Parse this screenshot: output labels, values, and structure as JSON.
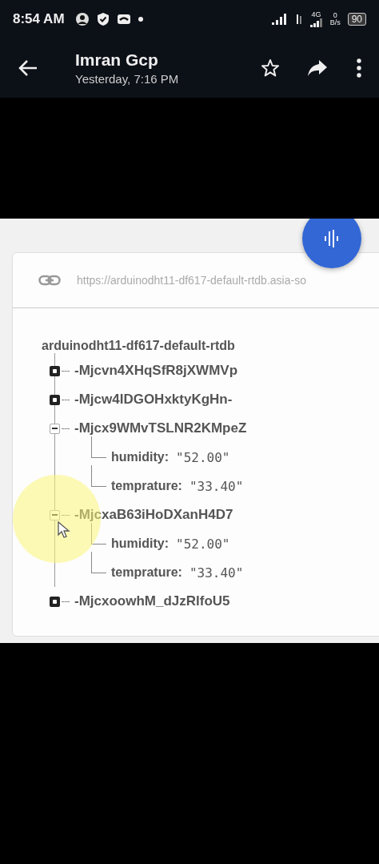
{
  "status_bar": {
    "time": "8:54 AM",
    "network": "4G",
    "speed_value": "0",
    "speed_unit": "B/s",
    "battery": "90"
  },
  "app_bar": {
    "title": "Imran Gcp",
    "subtitle": "Yesterday, 7:16 PM"
  },
  "image": {
    "url": "https://arduinodht11-df617-default-rtdb.asia-so",
    "tree": {
      "root": "arduinodht11-df617-default-rtdb",
      "children": [
        {
          "key": "-Mjcvn4XHqSfR8jXWMVp",
          "expanded": false
        },
        {
          "key": "-Mjcw4IDGOHxktyKgHn-",
          "expanded": false
        },
        {
          "key": "-Mjcx9WMvTSLNR2KMpeZ",
          "expanded": true,
          "children": [
            {
              "key": "humidity:",
              "value": "\"52.00\""
            },
            {
              "key": "temprature:",
              "value": "\"33.40\""
            }
          ]
        },
        {
          "key": "-MjcxaB63iHoDXanH4D7",
          "expanded": true,
          "children": [
            {
              "key": "humidity:",
              "value": "\"52.00\""
            },
            {
              "key": "temprature:",
              "value": "\"33.40\""
            }
          ]
        },
        {
          "key": "-MjcxoowhM_dJzRlfoU5",
          "expanded": false
        }
      ]
    }
  }
}
